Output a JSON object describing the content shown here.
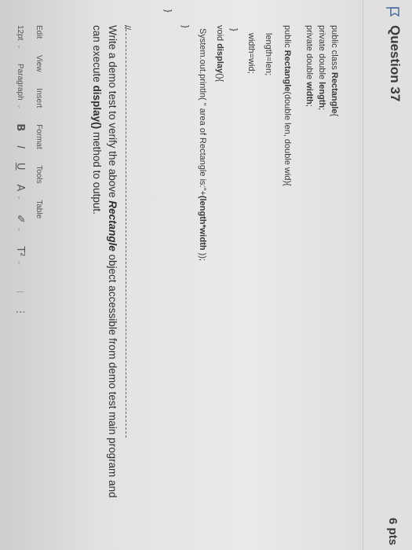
{
  "question": {
    "title": "Question 37",
    "points": "6 pts"
  },
  "code": {
    "l1_pre": "public class ",
    "l1_bold": "Rectangle",
    "l1_post": "{",
    "l2_pre": "private double ",
    "l2_bold": "length",
    "l2_post": ";",
    "l3_pre": "private double ",
    "l3_bold": "width",
    "l3_post": ";",
    "l4_pre": "public ",
    "l4_bold": "Rectangle",
    "l4_post": "(double len, double wid){",
    "l5": "length=len;",
    "l6": "width=wid;",
    "l7": "}",
    "l8_pre": "void ",
    "l8_bold": "display",
    "l8_post": "(){",
    "l9_pre": "System.out.println( \" area of Rectangle is:\"+",
    "l9_bold": "(length*width",
    "l9_post": " ));",
    "l10": "}",
    "l11": "}",
    "l12": "//"
  },
  "instruction": {
    "p1": "Write a demo test to verify the above ",
    "b1": "Rectangle",
    "p2": " object accessible from demo test main program and can execute ",
    "b2": "display()",
    "p3": " method to output."
  },
  "editor": {
    "menu": [
      "Edit",
      "View",
      "Insert",
      "Format",
      "Tools",
      "Table"
    ],
    "font_size": "12pt",
    "block_format": "Paragraph",
    "bold": "B",
    "italic": "I",
    "underline": "U",
    "text_color": "A",
    "highlight": "✐",
    "superscript": "T²",
    "more": "⋮"
  }
}
